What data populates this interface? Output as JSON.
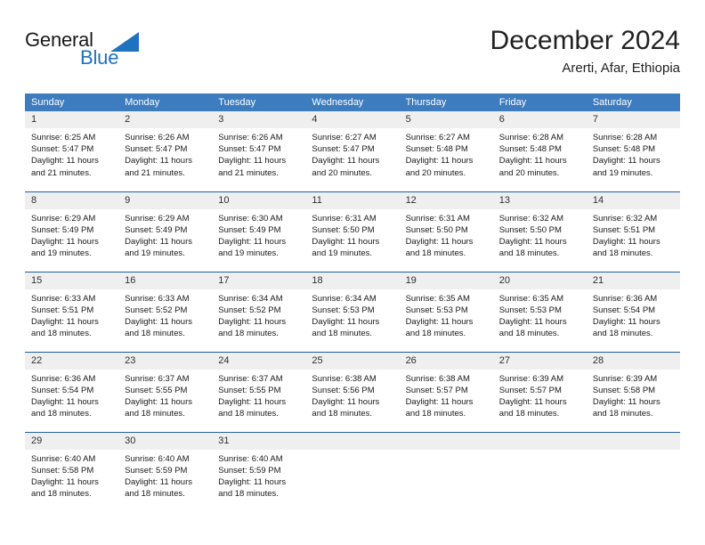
{
  "brand": {
    "name_part1": "General",
    "name_part2": "Blue",
    "triangle_color": "#1f72bd",
    "icon": "triangle-logo-icon"
  },
  "header": {
    "month_title": "December 2024",
    "location": "Arerti, Afar, Ethiopia"
  },
  "colors": {
    "header_blue": "#3c7cbf",
    "separator_blue": "#1f5fa8",
    "daynum_background": "#efefef",
    "brand_blue": "#1f72bd"
  },
  "calendar": {
    "weekday_headers": [
      "Sunday",
      "Monday",
      "Tuesday",
      "Wednesday",
      "Thursday",
      "Friday",
      "Saturday"
    ],
    "weeks": [
      [
        {
          "day": "1",
          "sunrise": "Sunrise: 6:25 AM",
          "sunset": "Sunset: 5:47 PM",
          "daylight_line1": "Daylight: 11 hours",
          "daylight_line2": "and 21 minutes."
        },
        {
          "day": "2",
          "sunrise": "Sunrise: 6:26 AM",
          "sunset": "Sunset: 5:47 PM",
          "daylight_line1": "Daylight: 11 hours",
          "daylight_line2": "and 21 minutes."
        },
        {
          "day": "3",
          "sunrise": "Sunrise: 6:26 AM",
          "sunset": "Sunset: 5:47 PM",
          "daylight_line1": "Daylight: 11 hours",
          "daylight_line2": "and 21 minutes."
        },
        {
          "day": "4",
          "sunrise": "Sunrise: 6:27 AM",
          "sunset": "Sunset: 5:47 PM",
          "daylight_line1": "Daylight: 11 hours",
          "daylight_line2": "and 20 minutes."
        },
        {
          "day": "5",
          "sunrise": "Sunrise: 6:27 AM",
          "sunset": "Sunset: 5:48 PM",
          "daylight_line1": "Daylight: 11 hours",
          "daylight_line2": "and 20 minutes."
        },
        {
          "day": "6",
          "sunrise": "Sunrise: 6:28 AM",
          "sunset": "Sunset: 5:48 PM",
          "daylight_line1": "Daylight: 11 hours",
          "daylight_line2": "and 20 minutes."
        },
        {
          "day": "7",
          "sunrise": "Sunrise: 6:28 AM",
          "sunset": "Sunset: 5:48 PM",
          "daylight_line1": "Daylight: 11 hours",
          "daylight_line2": "and 19 minutes."
        }
      ],
      [
        {
          "day": "8",
          "sunrise": "Sunrise: 6:29 AM",
          "sunset": "Sunset: 5:49 PM",
          "daylight_line1": "Daylight: 11 hours",
          "daylight_line2": "and 19 minutes."
        },
        {
          "day": "9",
          "sunrise": "Sunrise: 6:29 AM",
          "sunset": "Sunset: 5:49 PM",
          "daylight_line1": "Daylight: 11 hours",
          "daylight_line2": "and 19 minutes."
        },
        {
          "day": "10",
          "sunrise": "Sunrise: 6:30 AM",
          "sunset": "Sunset: 5:49 PM",
          "daylight_line1": "Daylight: 11 hours",
          "daylight_line2": "and 19 minutes."
        },
        {
          "day": "11",
          "sunrise": "Sunrise: 6:31 AM",
          "sunset": "Sunset: 5:50 PM",
          "daylight_line1": "Daylight: 11 hours",
          "daylight_line2": "and 19 minutes."
        },
        {
          "day": "12",
          "sunrise": "Sunrise: 6:31 AM",
          "sunset": "Sunset: 5:50 PM",
          "daylight_line1": "Daylight: 11 hours",
          "daylight_line2": "and 18 minutes."
        },
        {
          "day": "13",
          "sunrise": "Sunrise: 6:32 AM",
          "sunset": "Sunset: 5:50 PM",
          "daylight_line1": "Daylight: 11 hours",
          "daylight_line2": "and 18 minutes."
        },
        {
          "day": "14",
          "sunrise": "Sunrise: 6:32 AM",
          "sunset": "Sunset: 5:51 PM",
          "daylight_line1": "Daylight: 11 hours",
          "daylight_line2": "and 18 minutes."
        }
      ],
      [
        {
          "day": "15",
          "sunrise": "Sunrise: 6:33 AM",
          "sunset": "Sunset: 5:51 PM",
          "daylight_line1": "Daylight: 11 hours",
          "daylight_line2": "and 18 minutes."
        },
        {
          "day": "16",
          "sunrise": "Sunrise: 6:33 AM",
          "sunset": "Sunset: 5:52 PM",
          "daylight_line1": "Daylight: 11 hours",
          "daylight_line2": "and 18 minutes."
        },
        {
          "day": "17",
          "sunrise": "Sunrise: 6:34 AM",
          "sunset": "Sunset: 5:52 PM",
          "daylight_line1": "Daylight: 11 hours",
          "daylight_line2": "and 18 minutes."
        },
        {
          "day": "18",
          "sunrise": "Sunrise: 6:34 AM",
          "sunset": "Sunset: 5:53 PM",
          "daylight_line1": "Daylight: 11 hours",
          "daylight_line2": "and 18 minutes."
        },
        {
          "day": "19",
          "sunrise": "Sunrise: 6:35 AM",
          "sunset": "Sunset: 5:53 PM",
          "daylight_line1": "Daylight: 11 hours",
          "daylight_line2": "and 18 minutes."
        },
        {
          "day": "20",
          "sunrise": "Sunrise: 6:35 AM",
          "sunset": "Sunset: 5:53 PM",
          "daylight_line1": "Daylight: 11 hours",
          "daylight_line2": "and 18 minutes."
        },
        {
          "day": "21",
          "sunrise": "Sunrise: 6:36 AM",
          "sunset": "Sunset: 5:54 PM",
          "daylight_line1": "Daylight: 11 hours",
          "daylight_line2": "and 18 minutes."
        }
      ],
      [
        {
          "day": "22",
          "sunrise": "Sunrise: 6:36 AM",
          "sunset": "Sunset: 5:54 PM",
          "daylight_line1": "Daylight: 11 hours",
          "daylight_line2": "and 18 minutes."
        },
        {
          "day": "23",
          "sunrise": "Sunrise: 6:37 AM",
          "sunset": "Sunset: 5:55 PM",
          "daylight_line1": "Daylight: 11 hours",
          "daylight_line2": "and 18 minutes."
        },
        {
          "day": "24",
          "sunrise": "Sunrise: 6:37 AM",
          "sunset": "Sunset: 5:55 PM",
          "daylight_line1": "Daylight: 11 hours",
          "daylight_line2": "and 18 minutes."
        },
        {
          "day": "25",
          "sunrise": "Sunrise: 6:38 AM",
          "sunset": "Sunset: 5:56 PM",
          "daylight_line1": "Daylight: 11 hours",
          "daylight_line2": "and 18 minutes."
        },
        {
          "day": "26",
          "sunrise": "Sunrise: 6:38 AM",
          "sunset": "Sunset: 5:57 PM",
          "daylight_line1": "Daylight: 11 hours",
          "daylight_line2": "and 18 minutes."
        },
        {
          "day": "27",
          "sunrise": "Sunrise: 6:39 AM",
          "sunset": "Sunset: 5:57 PM",
          "daylight_line1": "Daylight: 11 hours",
          "daylight_line2": "and 18 minutes."
        },
        {
          "day": "28",
          "sunrise": "Sunrise: 6:39 AM",
          "sunset": "Sunset: 5:58 PM",
          "daylight_line1": "Daylight: 11 hours",
          "daylight_line2": "and 18 minutes."
        }
      ],
      [
        {
          "day": "29",
          "sunrise": "Sunrise: 6:40 AM",
          "sunset": "Sunset: 5:58 PM",
          "daylight_line1": "Daylight: 11 hours",
          "daylight_line2": "and 18 minutes."
        },
        {
          "day": "30",
          "sunrise": "Sunrise: 6:40 AM",
          "sunset": "Sunset: 5:59 PM",
          "daylight_line1": "Daylight: 11 hours",
          "daylight_line2": "and 18 minutes."
        },
        {
          "day": "31",
          "sunrise": "Sunrise: 6:40 AM",
          "sunset": "Sunset: 5:59 PM",
          "daylight_line1": "Daylight: 11 hours",
          "daylight_line2": "and 18 minutes."
        },
        {
          "day": "",
          "sunrise": "",
          "sunset": "",
          "daylight_line1": "",
          "daylight_line2": ""
        },
        {
          "day": "",
          "sunrise": "",
          "sunset": "",
          "daylight_line1": "",
          "daylight_line2": ""
        },
        {
          "day": "",
          "sunrise": "",
          "sunset": "",
          "daylight_line1": "",
          "daylight_line2": ""
        },
        {
          "day": "",
          "sunrise": "",
          "sunset": "",
          "daylight_line1": "",
          "daylight_line2": ""
        }
      ]
    ]
  }
}
